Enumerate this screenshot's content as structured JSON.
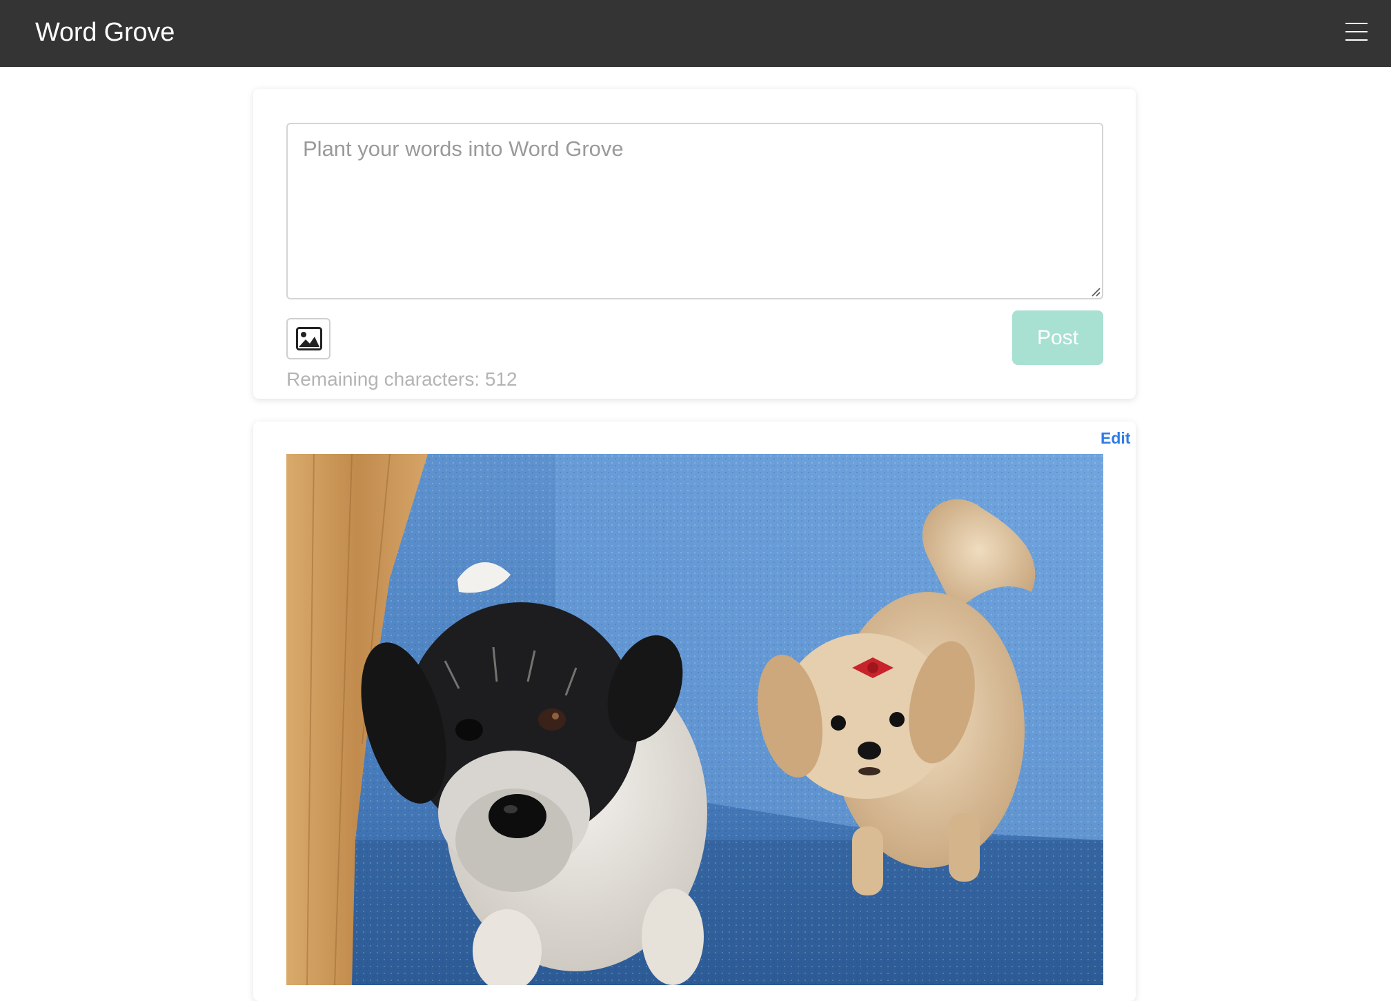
{
  "app": {
    "title": "Word Grove"
  },
  "composer": {
    "placeholder": "Plant your words into Word Grove",
    "value": "",
    "image_button_icon": "image-icon",
    "post_label": "Post",
    "remaining_label": "Remaining characters: 512"
  },
  "post": {
    "edit_label": "Edit",
    "photo": "photo of two small dogs on a blue rug next to a wooden floor"
  },
  "colors": {
    "navbar": "#343434",
    "post_button": "#a8e0d2",
    "edit_link": "#2f7be4",
    "rug": "#4a7fbf",
    "floor": "#c69656"
  }
}
